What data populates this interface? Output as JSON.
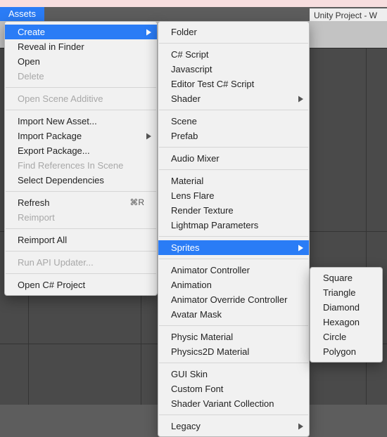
{
  "menubar": {
    "assets": "Assets"
  },
  "window_title": "Unity Project - W",
  "menu_assets": {
    "create": "Create",
    "reveal": "Reveal in Finder",
    "open": "Open",
    "delete": "Delete",
    "open_scene_additive": "Open Scene Additive",
    "import_new_asset": "Import New Asset...",
    "import_package": "Import Package",
    "export_package": "Export Package...",
    "find_refs": "Find References In Scene",
    "select_deps": "Select Dependencies",
    "refresh": "Refresh",
    "refresh_shortcut": "⌘R",
    "reimport": "Reimport",
    "reimport_all": "Reimport All",
    "run_api_updater": "Run API Updater...",
    "open_csharp": "Open C# Project"
  },
  "menu_create": {
    "folder": "Folder",
    "csharp_script": "C# Script",
    "javascript": "Javascript",
    "editor_test": "Editor Test C# Script",
    "shader": "Shader",
    "scene": "Scene",
    "prefab": "Prefab",
    "audio_mixer": "Audio Mixer",
    "material": "Material",
    "lens_flare": "Lens Flare",
    "render_texture": "Render Texture",
    "lightmap_params": "Lightmap Parameters",
    "sprites": "Sprites",
    "animator_controller": "Animator Controller",
    "animation": "Animation",
    "animator_override": "Animator Override Controller",
    "avatar_mask": "Avatar Mask",
    "physic_material": "Physic Material",
    "physics2d_material": "Physics2D Material",
    "gui_skin": "GUI Skin",
    "custom_font": "Custom Font",
    "shader_variant": "Shader Variant Collection",
    "legacy": "Legacy"
  },
  "menu_sprites": {
    "square": "Square",
    "triangle": "Triangle",
    "diamond": "Diamond",
    "hexagon": "Hexagon",
    "circle": "Circle",
    "polygon": "Polygon"
  }
}
